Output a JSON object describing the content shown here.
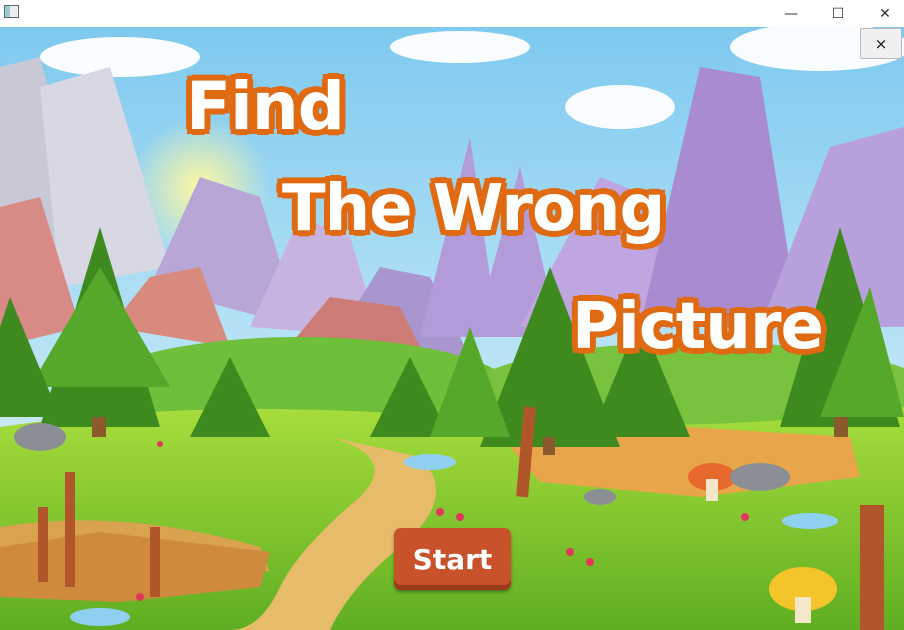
{
  "window": {
    "minimize_glyph": "—",
    "maximize_glyph": "☐",
    "close_glyph": "✕"
  },
  "game": {
    "title_lines": [
      "Find",
      "The Wrong",
      "Picture"
    ],
    "start_label": "Start",
    "close_label": "×"
  },
  "colors": {
    "title_outline": "#e06a12",
    "start_button": "#c8522a",
    "sky": "#9fd6f2",
    "grass": "#7cc62a"
  }
}
